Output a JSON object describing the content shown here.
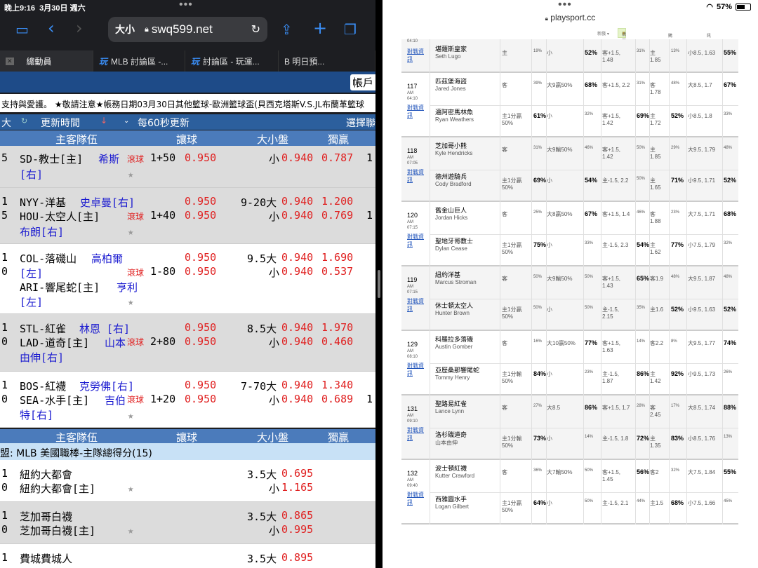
{
  "status_left": {
    "time": "晚上9:16",
    "date": "3月30日 週六"
  },
  "status_right": {
    "battery": "57%"
  },
  "browser_left": {
    "text_size": "大小",
    "url": "swq599.net"
  },
  "tabs": [
    {
      "label": "總動員"
    },
    {
      "label": "MLB 討論區 -..."
    },
    {
      "label": "討論區 - 玩運..."
    },
    {
      "label": "B 明日預..."
    }
  ],
  "left_banner": {
    "account": "帳戶"
  },
  "marquee": "支持與愛護。  ★敬請注意★帳務日期03月30日其他籃球-歐洲籃球盃(貝西克塔斯V.S.JL布蘭革籃球",
  "bar1": {
    "c1": "大",
    "c2": "更新時間",
    "c3": "每60秒更新",
    "c4": "選擇聯"
  },
  "bar2": {
    "team": "主客隊伍",
    "line": "讓球",
    "ou": "大小盤",
    "ml": "獨贏"
  },
  "bar2b": {
    "team": "主客隊伍",
    "line": "讓球",
    "ou": "大小盤",
    "ml": "獨贏"
  },
  "league2": "盟: MLB 美國職棒-主隊總得分(15)",
  "lrows": [
    {
      "n1": "5",
      "t1": "SD-教士[主]",
      "p1": "希斯",
      "t2": "[右]",
      "live": "滾球",
      "hc": "1+50",
      "o1": "0.950",
      "ou2": "小",
      "o3": "0.940",
      "m2": "0.787",
      "x2": "1"
    },
    {
      "n1": "1",
      "n2": "5",
      "t1": "NYY-洋基",
      "p1": "史卓曼[右]",
      "t2": "HOU-太空人[主]",
      "p2": "布朗[右]",
      "live": "滾球",
      "hc": "1+40",
      "o1": "0.950",
      "o2": "0.950",
      "ou1": "9-20大",
      "ou2": "小",
      "o3": "0.940",
      "o4": "0.940",
      "m1": "1.200",
      "m2": "0.769",
      "x2": "1"
    },
    {
      "n1": "1",
      "n2": "0",
      "t1": "COL-落磯山",
      "p1": "高柏爾",
      "t1b": "[左]",
      "t2": "ARI-響尾蛇[主]",
      "p2": "亨利",
      "t2b": "[左]",
      "live": "滾球",
      "hc": "1-80",
      "o1": "0.950",
      "o2": "0.950",
      "ou1": "9.5大",
      "ou2": "小",
      "o3": "0.940",
      "o4": "0.940",
      "m1": "1.690",
      "m2": "0.537"
    },
    {
      "n1": "1",
      "n2": "0",
      "t1": "STL-紅雀",
      "p1": "林恩 [右]",
      "t2": "LAD-道奇[主]",
      "p2": "山本",
      "p2b": "由伸[右]",
      "live": "滾球",
      "hc": "2+80",
      "o1": "0.950",
      "o2": "0.950",
      "ou1": "8.5大",
      "ou2": "小",
      "o3": "0.940",
      "o4": "0.940",
      "m1": "1.970",
      "m2": "0.460"
    },
    {
      "n1": "1",
      "n2": "0",
      "t1": "BOS-紅襪",
      "p1": "克勞佛[右]",
      "t2": "SEA-水手[主]",
      "p2": "吉伯",
      "p2b": "特[右]",
      "live": "滾球",
      "hc": "1+20",
      "o1": "0.950",
      "o2": "0.950",
      "ou1": "7-70大",
      "ou2": "小",
      "o3": "0.940",
      "o4": "0.940",
      "m1": "1.340",
      "m2": "0.689",
      "x1": "1",
      "x2": "1"
    }
  ],
  "lrows2": [
    {
      "n1": "1",
      "n2": "0",
      "t1": "紐約大都會",
      "t2": "紐約大都會[主]",
      "ou1": "3.5大",
      "o1": "0.695",
      "ou2": "小",
      "o2": "1.165"
    },
    {
      "n1": "1",
      "n2": "0",
      "t1": "芝加哥白襪",
      "t2": "芝加哥白襪[主]",
      "ou1": "3.5大",
      "o1": "0.865",
      "ou2": "小",
      "o2": "0.995"
    },
    {
      "n1": "1",
      "t1": "費城費城人",
      "ou1": "3.5大",
      "o1": "0.895"
    }
  ],
  "browser_right": {
    "url": "playsport.cc"
  },
  "rnav": {
    "n1": "新戲 ▾",
    "n2": "購買福幣",
    "n3": "購物清單",
    "n4": "訊息通知"
  },
  "games": [
    {
      "id": "",
      "ampm": "",
      "time": "04:10",
      "link": "對戰資訊",
      "away": {
        "cn": "",
        "en": "",
        "type": "",
        "pct1": "",
        "ou": "",
        "pct2": "",
        "hc": "",
        "pct3": "",
        "ml": "",
        "pct4": "",
        "tot": "",
        "pct5": ""
      },
      "home": {
        "cn": "堪薩斯皇家",
        "en": "Seth Lugo",
        "type": "主",
        "pct1": "19%",
        "ou": "小",
        "pct2": "52%",
        "hc": "客+1.5, 1.48",
        "pct3": "31%",
        "ml": "主 1.85",
        "pct4": "13%",
        "tot": "小8.5, 1.63",
        "pct5": "55%"
      }
    },
    {
      "id": "117",
      "ampm": "AM",
      "time": "04:10",
      "link": "對戰資訊",
      "away": {
        "cn": "匹茲堡海盜",
        "en": "Jared Jones",
        "type": "客",
        "pct1": "39%",
        "ou": "大9贏50%",
        "pct2": "68%",
        "hc": "客+1.5, 2.2",
        "pct3": "31%",
        "ml": "客 1.78",
        "pct4": "48%",
        "tot": "大8.5, 1.7",
        "pct5": "67%"
      },
      "home": {
        "cn": "邁阿密馬林魚",
        "en": "Ryan Weathers",
        "type": "主1分贏50%",
        "pct1": "61%",
        "ou": "小",
        "pct2": "32%",
        "hc": "客+1.5, 1.42",
        "pct3": "69%",
        "ml": "主 1.72",
        "pct4": "52%",
        "tot": "小8.5, 1.8",
        "pct5": "33%"
      }
    },
    {
      "id": "118",
      "ampm": "AM",
      "time": "07:05",
      "link": "對戰資訊",
      "away": {
        "cn": "芝加哥小熊",
        "en": "Kyle Hendricks",
        "type": "客",
        "pct1": "31%",
        "ou": "大9輸50%",
        "pct2": "46%",
        "hc": "客+1.5, 1.42",
        "pct3": "50%",
        "ml": "主 1.85",
        "pct4": "29%",
        "tot": "大9.5, 1.79",
        "pct5": "48%"
      },
      "home": {
        "cn": "德州遊騎兵",
        "en": "Cody Bradford",
        "type": "主1分贏50%",
        "pct1": "69%",
        "ou": "小",
        "pct2": "54%",
        "hc": "主-1.5, 2.2",
        "pct3": "50%",
        "ml": "主 1.65",
        "pct4": "71%",
        "tot": "小9.5, 1.71",
        "pct5": "52%"
      }
    },
    {
      "id": "120",
      "ampm": "AM",
      "time": "07:15",
      "link": "對戰資訊",
      "away": {
        "cn": "舊金山巨人",
        "en": "Jordan Hicks",
        "type": "客",
        "pct1": "25%",
        "ou": "大8贏50%",
        "pct2": "67%",
        "hc": "客+1.5, 1.4",
        "pct3": "46%",
        "ml": "客 1.88",
        "pct4": "23%",
        "tot": "大7.5, 1.71",
        "pct5": "68%"
      },
      "home": {
        "cn": "聖地牙哥教士",
        "en": "Dylan Cease",
        "type": "主1分贏50%",
        "pct1": "75%",
        "ou": "小",
        "pct2": "33%",
        "hc": "主-1.5, 2.3",
        "pct3": "54%",
        "ml": "主 1.62",
        "pct4": "77%",
        "tot": "小7.5, 1.79",
        "pct5": "32%"
      }
    },
    {
      "id": "119",
      "ampm": "AM",
      "time": "07:15",
      "link": "對戰資訊",
      "away": {
        "cn": "紐約洋基",
        "en": "Marcus Stroman",
        "type": "客",
        "pct1": "50%",
        "ou": "大9輸50%",
        "pct2": "50%",
        "hc": "客+1.5, 1.43",
        "pct3": "65%",
        "ml": "客1.9",
        "pct4": "48%",
        "tot": "大9.5, 1.87",
        "pct5": "48%"
      },
      "home": {
        "cn": "休士頓太空人",
        "en": "Hunter Brown",
        "type": "主1分贏50%",
        "pct1": "50%",
        "ou": "小",
        "pct2": "50%",
        "hc": "主-1.5, 2.15",
        "pct3": "35%",
        "ml": "主1.6",
        "pct4": "52%",
        "tot": "小9.5, 1.63",
        "pct5": "52%"
      }
    },
    {
      "id": "129",
      "ampm": "AM",
      "time": "08:10",
      "link": "對戰資訊",
      "away": {
        "cn": "科羅拉多落磯",
        "en": "Austin Gomber",
        "type": "客",
        "pct1": "16%",
        "ou": "大10贏50%",
        "pct2": "77%",
        "hc": "客+1.5, 1.63",
        "pct3": "14%",
        "ml": "客2.2",
        "pct4": "8%",
        "tot": "大9.5, 1.77",
        "pct5": "74%"
      },
      "home": {
        "cn": "亞歷桑那響尾蛇",
        "en": "Tommy Henry",
        "type": "主1分輸50%",
        "pct1": "84%",
        "ou": "小",
        "pct2": "23%",
        "hc": "主-1.5, 1.87",
        "pct3": "86%",
        "ml": "主 1.42",
        "pct4": "92%",
        "tot": "小9.5, 1.73",
        "pct5": "26%"
      }
    },
    {
      "id": "131",
      "ampm": "AM",
      "time": "09:10",
      "link": "對戰資訊",
      "away": {
        "cn": "聖路易紅雀",
        "en": "Lance Lynn",
        "type": "客",
        "pct1": "27%",
        "ou": "大8.5",
        "pct2": "86%",
        "hc": "客+1.5, 1.7",
        "pct3": "28%",
        "ml": "客 2.45",
        "pct4": "17%",
        "tot": "大8.5, 1.74",
        "pct5": "88%"
      },
      "home": {
        "cn": "洛杉磯道奇",
        "en": "山本由伸",
        "type": "主1分輸50%",
        "pct1": "73%",
        "ou": "小",
        "pct2": "14%",
        "hc": "主-1.5, 1.8",
        "pct3": "72%",
        "ml": "主 1.35",
        "pct4": "83%",
        "tot": "小8.5, 1.76",
        "pct5": "13%"
      }
    },
    {
      "id": "132",
      "ampm": "AM",
      "time": "09:40",
      "link": "對戰資訊",
      "away": {
        "cn": "波士頓紅襪",
        "en": "Kutter Crawford",
        "type": "客",
        "pct1": "36%",
        "ou": "大7輸50%",
        "pct2": "50%",
        "hc": "客+1.5, 1.45",
        "pct3": "56%",
        "ml": "客2",
        "pct4": "32%",
        "tot": "大7.5, 1.84",
        "pct5": "55%"
      },
      "home": {
        "cn": "西雅圖水手",
        "en": "Logan Gilbert",
        "type": "主1分贏50%",
        "pct1": "64%",
        "ou": "小",
        "pct2": "50%",
        "hc": "主-1.5, 2.1",
        "pct3": "44%",
        "ml": "主1.5",
        "pct4": "68%",
        "tot": "小7.5, 1.66",
        "pct5": "45%"
      }
    }
  ]
}
